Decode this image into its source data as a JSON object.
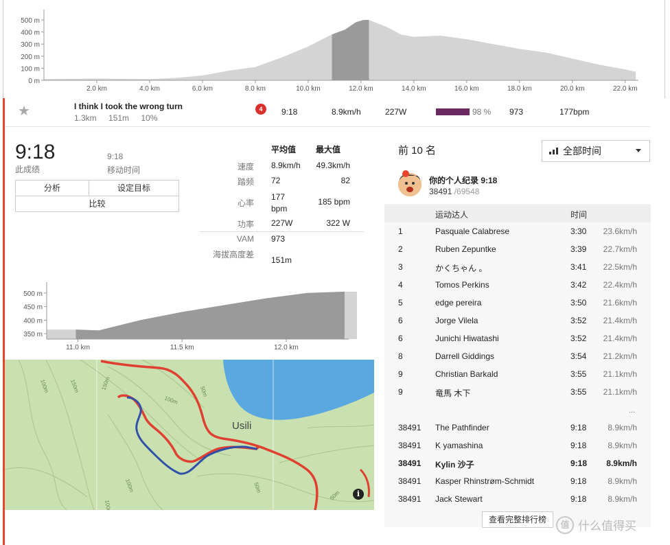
{
  "elevation_profile": {
    "y_ticks": [
      "500 m",
      "400 m",
      "300 m",
      "200 m",
      "100 m",
      "0 m"
    ],
    "x_ticks": [
      "2.0 km",
      "4.0 km",
      "6.0 km",
      "8.0 km",
      "10.0 km",
      "12.0 km",
      "14.0 km",
      "16.0 km",
      "18.0 km",
      "20.0 km",
      "22.0 km"
    ],
    "x_range_km": [
      0,
      22.5
    ],
    "y_range_m": [
      0,
      540
    ],
    "highlight_km": [
      10.9,
      12.3
    ],
    "profile_points_km_m": [
      [
        0,
        10
      ],
      [
        1,
        12
      ],
      [
        2,
        14
      ],
      [
        3,
        12
      ],
      [
        4,
        10
      ],
      [
        5,
        20
      ],
      [
        6,
        40
      ],
      [
        7,
        80
      ],
      [
        8,
        110
      ],
      [
        9,
        190
      ],
      [
        10,
        280
      ],
      [
        10.9,
        380
      ],
      [
        11.4,
        420
      ],
      [
        11.8,
        480
      ],
      [
        12.1,
        500
      ],
      [
        12.3,
        500
      ],
      [
        13,
        440
      ],
      [
        13.5,
        380
      ],
      [
        14,
        360
      ],
      [
        15,
        370
      ],
      [
        16,
        340
      ],
      [
        17,
        300
      ],
      [
        18,
        260
      ],
      [
        19,
        230
      ],
      [
        20,
        180
      ],
      [
        21,
        130
      ],
      [
        22,
        90
      ],
      [
        22.4,
        70
      ]
    ]
  },
  "effort": {
    "star_icon": "star-icon",
    "segment_name": "I think I took the wrong turn",
    "distance": "1.3km",
    "elev": "151m",
    "grade": "10%",
    "achievement_count": "4",
    "time": "9:18",
    "speed": "8.9km/h",
    "power": "227W",
    "pr_percent": 0.98,
    "pr_percent_label": "98 %",
    "vam": "973",
    "hr": "177bpm"
  },
  "summary": {
    "elapsed_time": "9:18",
    "elapsed_label": "此成绩",
    "moving_time": "9:18",
    "moving_label": "移动时间",
    "btn_analysis": "分析",
    "btn_goal": "设定目标",
    "btn_compare": "比较"
  },
  "stats": {
    "col_avg": "平均值",
    "col_max": "最大值",
    "rows": [
      {
        "label": "速度",
        "avg": "8.9km/h",
        "max": "49.3km/h"
      },
      {
        "label": "踏频",
        "avg": "72",
        "max": "82"
      },
      {
        "label": "心率",
        "avg": "177 bpm",
        "max": "185 bpm"
      },
      {
        "label": "功率",
        "avg": "227W",
        "max": "322 W"
      }
    ],
    "vam_label": "VAM",
    "vam_value": "973",
    "elev_label": "海拔高度差",
    "elev_value": "151m"
  },
  "segment_profile": {
    "y_ticks": [
      "500 m",
      "450 m",
      "400 m",
      "350 m"
    ],
    "x_ticks": [
      "11.0 km",
      "11.5 km",
      "12.0 km"
    ],
    "x_range_km": [
      10.85,
      12.3
    ],
    "y_range_m": [
      330,
      520
    ],
    "segment_km": [
      10.99,
      12.28
    ],
    "profile_points_km_m": [
      [
        10.85,
        365
      ],
      [
        10.99,
        365
      ],
      [
        11.1,
        362
      ],
      [
        11.3,
        400
      ],
      [
        11.5,
        430
      ],
      [
        11.7,
        455
      ],
      [
        11.9,
        480
      ],
      [
        12.1,
        500
      ],
      [
        12.28,
        505
      ],
      [
        12.4,
        505
      ]
    ]
  },
  "map": {
    "place_label": "Usili",
    "contour_labels": [
      "100m",
      "150m",
      "150m",
      "50m",
      "100m",
      "100m",
      "50m",
      "50m",
      "100m"
    ],
    "info_icon": "info-icon"
  },
  "leaderboard": {
    "title": "前 10 名",
    "filter_label": "全部时间",
    "pr_line": "你的个人纪录 9:18",
    "pr_rank": "38491",
    "pr_total": "/69548",
    "col_athlete": "运动达人",
    "col_time": "时间",
    "top_rows": [
      {
        "rank": "1",
        "name": "Pasquale Calabrese",
        "time": "3:30",
        "speed": "23.6km/h"
      },
      {
        "rank": "2",
        "name": "Ruben Zepuntke",
        "time": "3:39",
        "speed": "22.7km/h"
      },
      {
        "rank": "3",
        "name": "かくちゃん 。",
        "time": "3:41",
        "speed": "22.5km/h"
      },
      {
        "rank": "4",
        "name": "Tomos Perkins",
        "time": "3:42",
        "speed": "22.4km/h"
      },
      {
        "rank": "5",
        "name": "edge pereira",
        "time": "3:50",
        "speed": "21.6km/h"
      },
      {
        "rank": "6",
        "name": "Jorge Vilela",
        "time": "3:52",
        "speed": "21.4km/h"
      },
      {
        "rank": "6",
        "name": "Junichi Hiwatashi",
        "time": "3:52",
        "speed": "21.4km/h"
      },
      {
        "rank": "8",
        "name": "Darrell Giddings",
        "time": "3:54",
        "speed": "21.2km/h"
      },
      {
        "rank": "9",
        "name": "Christian Barkald",
        "time": "3:55",
        "speed": "21.1km/h"
      },
      {
        "rank": "9",
        "name": "竜馬 木下",
        "time": "3:55",
        "speed": "21.1km/h"
      }
    ],
    "ellipsis": "...",
    "near_rows": [
      {
        "rank": "38491",
        "name": "The Pathfinder",
        "time": "9:18",
        "speed": "8.9km/h",
        "me": false
      },
      {
        "rank": "38491",
        "name": "K yamashina",
        "time": "9:18",
        "speed": "8.9km/h",
        "me": false
      },
      {
        "rank": "38491",
        "name": "Kylin 沙子",
        "time": "9:18",
        "speed": "8.9km/h",
        "me": true
      },
      {
        "rank": "38491",
        "name": "Kasper Rhinstrøm-Schmidt",
        "time": "9:18",
        "speed": "8.9km/h",
        "me": false
      },
      {
        "rank": "38491",
        "name": "Jack Stewart",
        "time": "9:18",
        "speed": "8.9km/h",
        "me": false
      }
    ],
    "full_button": "查看完整排行榜"
  },
  "watermark": {
    "icon_char": "值",
    "text": "什么值得买"
  },
  "colors": {
    "accent": "#e8452c",
    "profile_fill": "#d4d4d4",
    "profile_highlight": "#9a9a9a",
    "pr_bar": "#6b2a5f",
    "route_red": "#e04030",
    "route_blue": "#3050a8",
    "water": "#5aa8e0",
    "land": "#c9e0b0"
  }
}
